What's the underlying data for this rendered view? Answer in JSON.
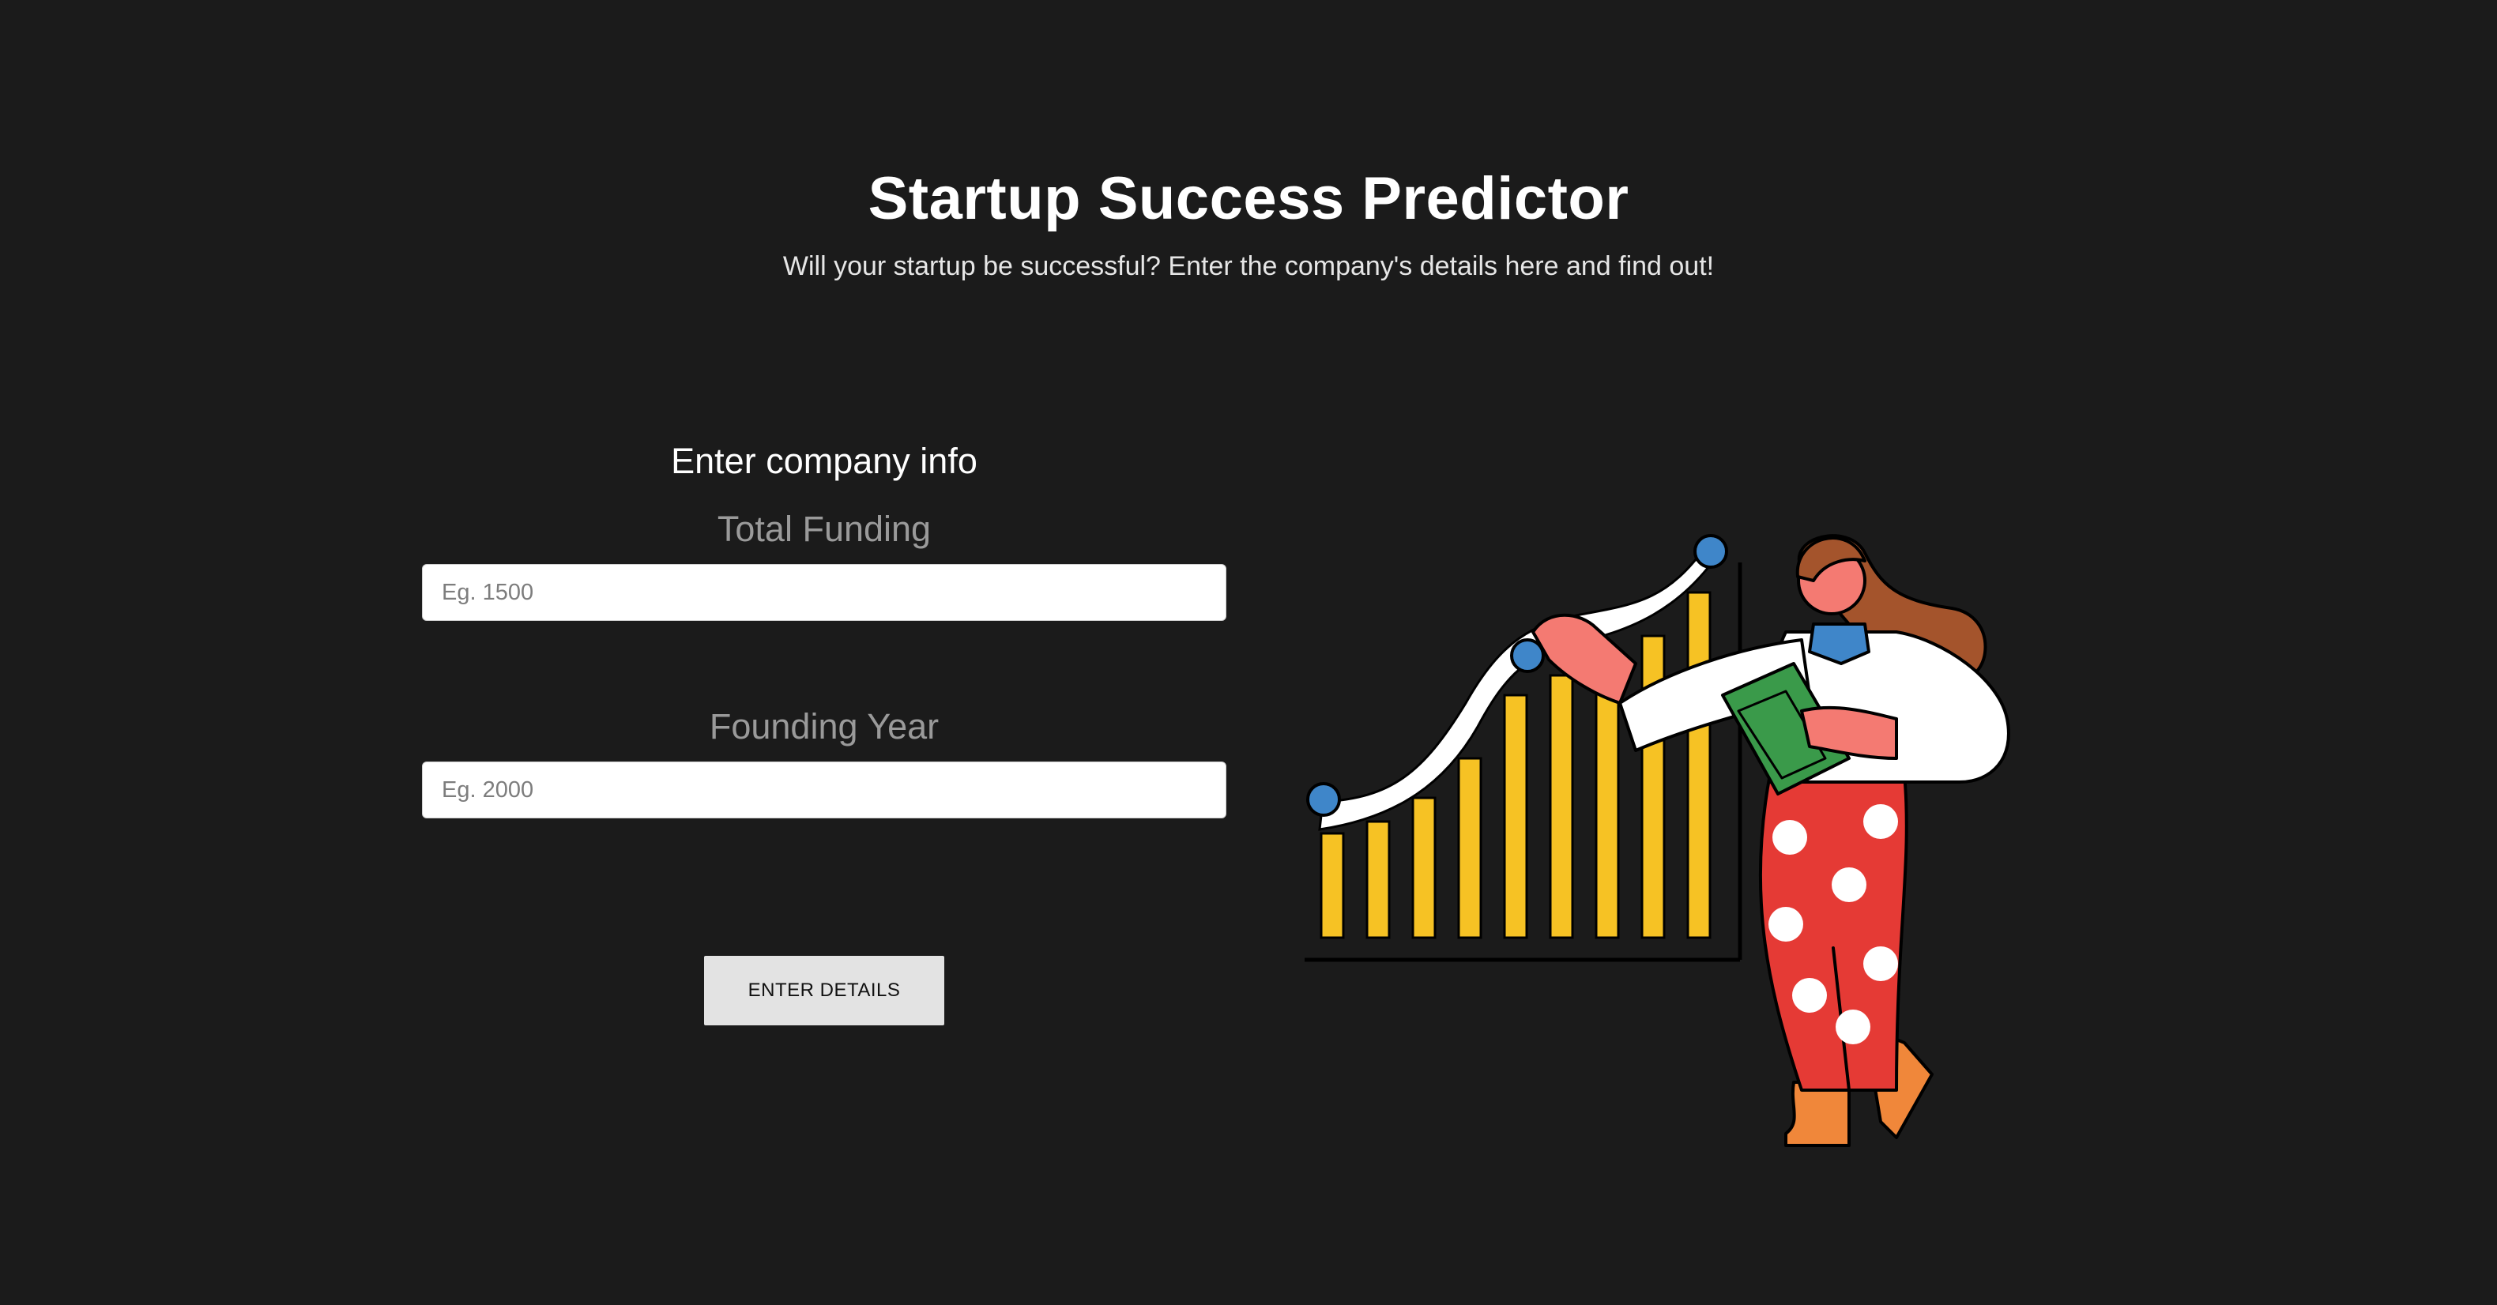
{
  "header": {
    "title": "Startup Success Predictor",
    "subtitle": "Will your startup be successful? Enter the company's details here and find out!"
  },
  "form": {
    "heading": "Enter company info",
    "fields": [
      {
        "label": "Total Funding",
        "placeholder": "Eg. 1500",
        "value": ""
      },
      {
        "label": "Founding Year",
        "placeholder": "Eg. 2000",
        "value": ""
      }
    ],
    "submit_label": "ENTER DETAILS"
  },
  "colors": {
    "background": "#1b1b1b",
    "chart_bars": "#f6c224",
    "accent_dots": "#3f86c9",
    "pants": "#e53a35",
    "book": "#3a9a4a",
    "boots": "#f0873a",
    "hair": "#a4542c",
    "skin": "#f47a72"
  },
  "illustration": {
    "icon": "woman-presenting-growth-chart-illustration"
  }
}
